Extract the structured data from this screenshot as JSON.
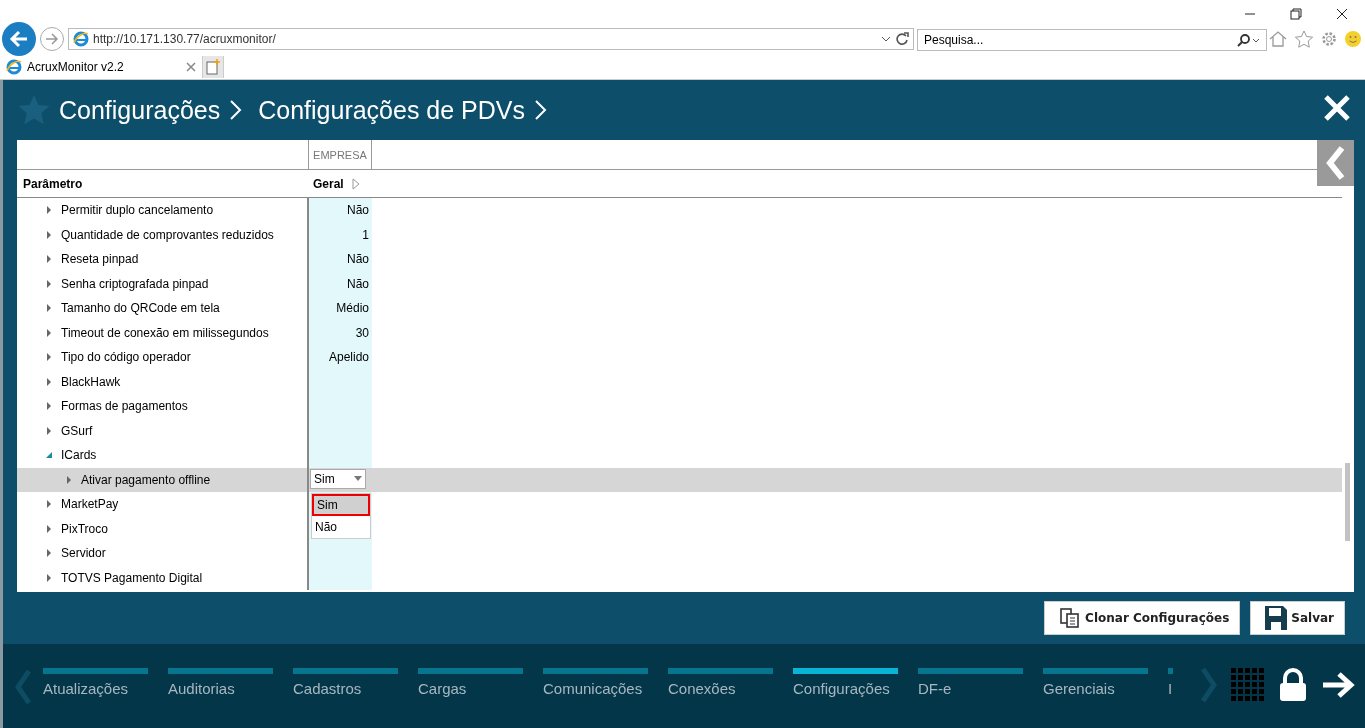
{
  "browser": {
    "address": "http://10.171.130.77/acruxmonitor/",
    "search_placeholder": "Pesquisa...",
    "tab_title": "AcruxMonitor v2.2"
  },
  "header": {
    "breadcrumbs": [
      "Configurações",
      "Configurações de PDVs"
    ]
  },
  "table": {
    "group_header": "EMPRESA",
    "columns": [
      "Parâmetro",
      "Geral"
    ],
    "rows": [
      {
        "label": "Permitir duplo cancelamento",
        "value": "Não",
        "expanded": false,
        "selected": false
      },
      {
        "label": "Quantidade de comprovantes reduzidos",
        "value": "1",
        "expanded": false,
        "selected": false
      },
      {
        "label": "Reseta pinpad",
        "value": "Não",
        "expanded": false,
        "selected": false
      },
      {
        "label": "Senha criptografada pinpad",
        "value": "Não",
        "expanded": false,
        "selected": false
      },
      {
        "label": "Tamanho do QRCode em tela",
        "value": "Médio",
        "expanded": false,
        "selected": false
      },
      {
        "label": "Timeout de conexão em milissegundos",
        "value": "30",
        "expanded": false,
        "selected": false
      },
      {
        "label": "Tipo do código operador",
        "value": "Apelido",
        "expanded": false,
        "selected": false
      },
      {
        "label": "BlackHawk",
        "expanded": false,
        "selected": false
      },
      {
        "label": "Formas de pagamentos",
        "expanded": false,
        "selected": false
      },
      {
        "label": "GSurf",
        "expanded": false,
        "selected": false
      },
      {
        "label": "ICards",
        "expanded": true,
        "selected": false,
        "children": [
          {
            "label": "Ativar pagamento offline",
            "expanded": false,
            "selected": true,
            "dropdown": {
              "value": "Sim",
              "options": [
                {
                  "label": "Sim",
                  "selected": true
                },
                {
                  "label": "Não",
                  "selected": false
                }
              ]
            }
          }
        ]
      },
      {
        "label": "MarketPay",
        "expanded": false,
        "selected": false
      },
      {
        "label": "PixTroco",
        "expanded": false,
        "selected": false
      },
      {
        "label": "Servidor",
        "expanded": false,
        "selected": false
      },
      {
        "label": "TOTVS Pagamento Digital",
        "expanded": false,
        "selected": false
      }
    ]
  },
  "buttons": [
    {
      "label": "Clonar Configurações",
      "kind": "clone"
    },
    {
      "label": "Salvar",
      "kind": "save"
    }
  ],
  "bottom_nav": [
    {
      "label": "Atualizações",
      "selected": false
    },
    {
      "label": "Auditorias",
      "selected": false
    },
    {
      "label": "Cadastros",
      "selected": false
    },
    {
      "label": "Cargas",
      "selected": false
    },
    {
      "label": "Comunicações",
      "selected": false
    },
    {
      "label": "Conexões",
      "selected": false
    },
    {
      "label": "Configurações",
      "selected": true
    },
    {
      "label": "DF-e",
      "selected": false
    },
    {
      "label": "Gerenciais",
      "selected": false
    },
    {
      "label": "I",
      "selected": false
    }
  ]
}
